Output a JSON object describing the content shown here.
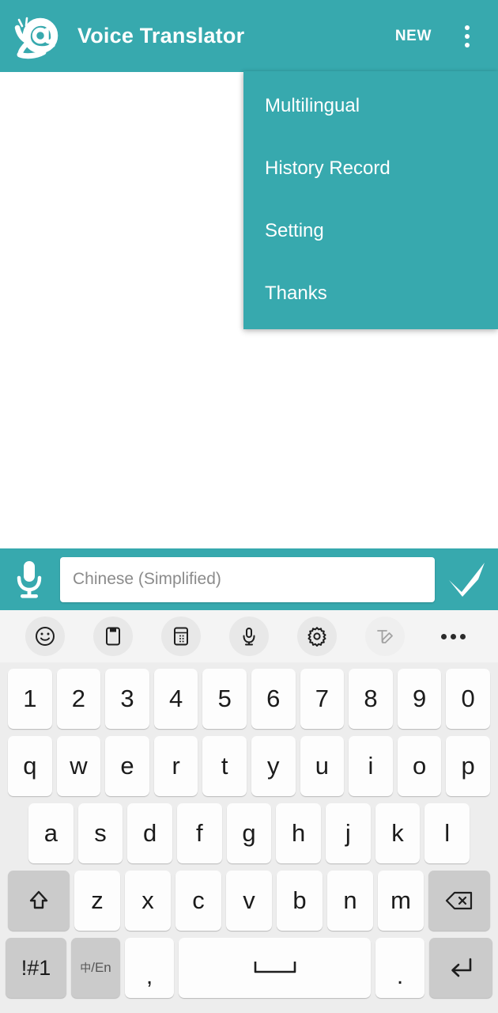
{
  "app": {
    "title": "Voice Translator",
    "new_label": "NEW",
    "logo_icon": "snail-at-logo",
    "overflow_icon": "overflow-menu-icon",
    "accent_color": "#37A9AE"
  },
  "menu": {
    "items": [
      {
        "label": "Multilingual"
      },
      {
        "label": "History Record"
      },
      {
        "label": "Setting"
      },
      {
        "label": "Thanks"
      }
    ]
  },
  "input_bar": {
    "mic_icon": "microphone-icon",
    "field_value": "",
    "field_placeholder": "Chinese (Simplified)",
    "confirm_icon": "checkmark-icon"
  },
  "keyboard": {
    "toolbar": [
      {
        "name": "emoji-icon",
        "enabled": true
      },
      {
        "name": "clipboard-icon",
        "enabled": true
      },
      {
        "name": "keyboard-layout-icon",
        "enabled": true
      },
      {
        "name": "voice-input-icon",
        "enabled": true
      },
      {
        "name": "settings-gear-icon",
        "enabled": true
      },
      {
        "name": "handwriting-icon",
        "enabled": false
      },
      {
        "name": "more-options-icon",
        "enabled": true
      }
    ],
    "rows": {
      "numbers": [
        "1",
        "2",
        "3",
        "4",
        "5",
        "6",
        "7",
        "8",
        "9",
        "0"
      ],
      "qwerty": [
        "q",
        "w",
        "e",
        "r",
        "t",
        "y",
        "u",
        "i",
        "o",
        "p"
      ],
      "asdf": [
        "a",
        "s",
        "d",
        "f",
        "g",
        "h",
        "j",
        "k",
        "l"
      ],
      "zxcv": [
        "z",
        "x",
        "c",
        "v",
        "b",
        "n",
        "m"
      ],
      "shift_icon": "shift-icon",
      "delete_icon": "backspace-icon",
      "symbols_label": "!#1",
      "lang_toggle_cn": "中",
      "lang_toggle_sep": "/En",
      "comma": ",",
      "space_icon": "space-icon",
      "period": ".",
      "enter_icon": "enter-icon"
    }
  }
}
